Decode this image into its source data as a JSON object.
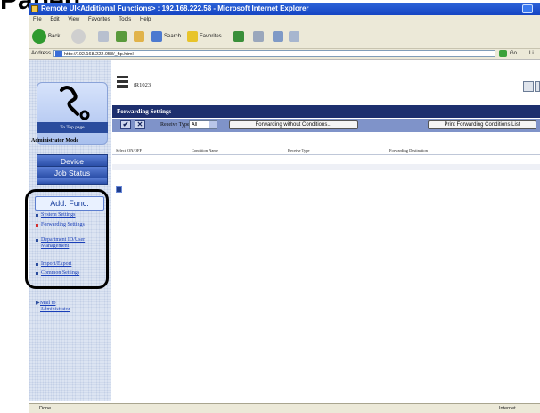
{
  "caption": "Panel]",
  "window": {
    "title": "Remote UI<Additional Functions> : 192.168.222.58 - Microsoft Internet Explorer"
  },
  "menubar": [
    "File",
    "Edit",
    "View",
    "Favorites",
    "Tools",
    "Help"
  ],
  "toolbar": {
    "back": "Back",
    "search": "Search",
    "favorites": "Favorites"
  },
  "address": {
    "label": "Address",
    "url": "http://192.168.222.058/_ftp.html",
    "go": "Go",
    "links": "Li"
  },
  "sidebar": {
    "top_page": "To Top page",
    "mode": "Administrator Mode",
    "nav": [
      "Device",
      "Job Status"
    ],
    "active": "Add. Func.",
    "sub": [
      "System Settings",
      "Forwarding Settings",
      "Department ID/User Management",
      "Import/Export",
      "Common Settings"
    ],
    "mail": "Mail to Administrator"
  },
  "main": {
    "printer_id": "iR1023",
    "section_title": "Forwarding Settings",
    "receive_type_label": "Receive Type",
    "receive_type_value": "All",
    "buttons": [
      "Forwarding without Conditions...",
      "Print Forwarding Conditions List"
    ],
    "columns": [
      "Select",
      "ON/OFF",
      "Condition Name",
      "Receive Type",
      "Forwarding Destination"
    ]
  },
  "status": {
    "left": "Done",
    "zone": "Internet"
  },
  "colors": {
    "titlebar": "#1c4fc8",
    "section": "#1d2f6e",
    "nav": "#2b4fa8",
    "panel": "#dce4f2"
  }
}
